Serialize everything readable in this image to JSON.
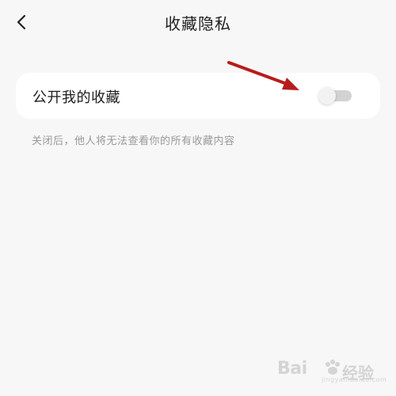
{
  "header": {
    "title": "收藏隐私",
    "back_icon": "chevron-left-icon"
  },
  "settings": {
    "public_favorites": {
      "label": "公开我的收藏",
      "enabled": false
    },
    "hint": "关闭后，他人将无法查看你的所有收藏内容"
  },
  "annotation": {
    "arrow_color": "#b71c1c"
  },
  "watermark": {
    "brand": "Bai",
    "brand_cn": "经验",
    "sub": "jingyan.baidu.com"
  },
  "colors": {
    "background": "#f7f7f7",
    "card": "#ffffff",
    "toggle_off_track": "#d2d2d2"
  }
}
